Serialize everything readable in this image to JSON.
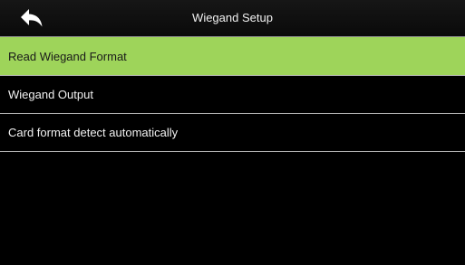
{
  "header": {
    "title": "Wiegand Setup",
    "back_icon": "back-arrow-icon"
  },
  "menu": {
    "items": [
      {
        "label": "Read Wiegand Format",
        "selected": true
      },
      {
        "label": "Wiegand Output",
        "selected": false
      },
      {
        "label": "Card format detect automatically",
        "selected": false
      }
    ]
  },
  "colors": {
    "background": "#000000",
    "selected_row": "#9ed45a",
    "divider": "#b0b0b0"
  }
}
